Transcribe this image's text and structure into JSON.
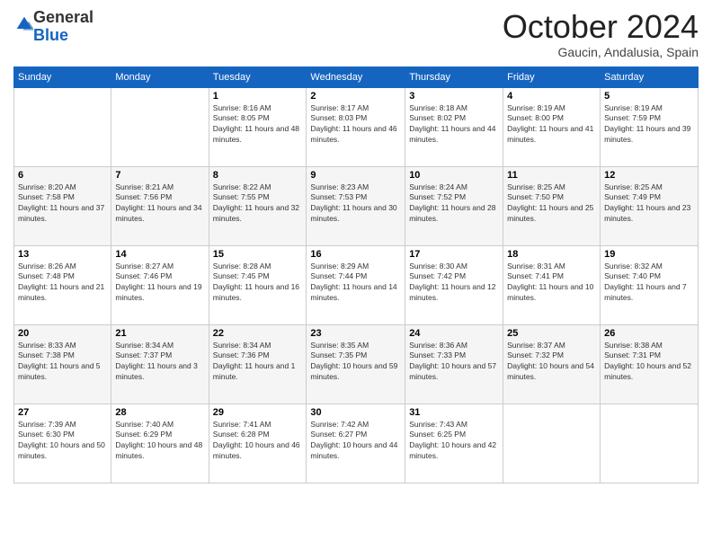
{
  "logo": {
    "general": "General",
    "blue": "Blue"
  },
  "header": {
    "month": "October 2024",
    "location": "Gaucin, Andalusia, Spain"
  },
  "weekdays": [
    "Sunday",
    "Monday",
    "Tuesday",
    "Wednesday",
    "Thursday",
    "Friday",
    "Saturday"
  ],
  "weeks": [
    [
      {
        "day": "",
        "info": ""
      },
      {
        "day": "",
        "info": ""
      },
      {
        "day": "1",
        "info": "Sunrise: 8:16 AM\nSunset: 8:05 PM\nDaylight: 11 hours and 48 minutes."
      },
      {
        "day": "2",
        "info": "Sunrise: 8:17 AM\nSunset: 8:03 PM\nDaylight: 11 hours and 46 minutes."
      },
      {
        "day": "3",
        "info": "Sunrise: 8:18 AM\nSunset: 8:02 PM\nDaylight: 11 hours and 44 minutes."
      },
      {
        "day": "4",
        "info": "Sunrise: 8:19 AM\nSunset: 8:00 PM\nDaylight: 11 hours and 41 minutes."
      },
      {
        "day": "5",
        "info": "Sunrise: 8:19 AM\nSunset: 7:59 PM\nDaylight: 11 hours and 39 minutes."
      }
    ],
    [
      {
        "day": "6",
        "info": "Sunrise: 8:20 AM\nSunset: 7:58 PM\nDaylight: 11 hours and 37 minutes."
      },
      {
        "day": "7",
        "info": "Sunrise: 8:21 AM\nSunset: 7:56 PM\nDaylight: 11 hours and 34 minutes."
      },
      {
        "day": "8",
        "info": "Sunrise: 8:22 AM\nSunset: 7:55 PM\nDaylight: 11 hours and 32 minutes."
      },
      {
        "day": "9",
        "info": "Sunrise: 8:23 AM\nSunset: 7:53 PM\nDaylight: 11 hours and 30 minutes."
      },
      {
        "day": "10",
        "info": "Sunrise: 8:24 AM\nSunset: 7:52 PM\nDaylight: 11 hours and 28 minutes."
      },
      {
        "day": "11",
        "info": "Sunrise: 8:25 AM\nSunset: 7:50 PM\nDaylight: 11 hours and 25 minutes."
      },
      {
        "day": "12",
        "info": "Sunrise: 8:25 AM\nSunset: 7:49 PM\nDaylight: 11 hours and 23 minutes."
      }
    ],
    [
      {
        "day": "13",
        "info": "Sunrise: 8:26 AM\nSunset: 7:48 PM\nDaylight: 11 hours and 21 minutes."
      },
      {
        "day": "14",
        "info": "Sunrise: 8:27 AM\nSunset: 7:46 PM\nDaylight: 11 hours and 19 minutes."
      },
      {
        "day": "15",
        "info": "Sunrise: 8:28 AM\nSunset: 7:45 PM\nDaylight: 11 hours and 16 minutes."
      },
      {
        "day": "16",
        "info": "Sunrise: 8:29 AM\nSunset: 7:44 PM\nDaylight: 11 hours and 14 minutes."
      },
      {
        "day": "17",
        "info": "Sunrise: 8:30 AM\nSunset: 7:42 PM\nDaylight: 11 hours and 12 minutes."
      },
      {
        "day": "18",
        "info": "Sunrise: 8:31 AM\nSunset: 7:41 PM\nDaylight: 11 hours and 10 minutes."
      },
      {
        "day": "19",
        "info": "Sunrise: 8:32 AM\nSunset: 7:40 PM\nDaylight: 11 hours and 7 minutes."
      }
    ],
    [
      {
        "day": "20",
        "info": "Sunrise: 8:33 AM\nSunset: 7:38 PM\nDaylight: 11 hours and 5 minutes."
      },
      {
        "day": "21",
        "info": "Sunrise: 8:34 AM\nSunset: 7:37 PM\nDaylight: 11 hours and 3 minutes."
      },
      {
        "day": "22",
        "info": "Sunrise: 8:34 AM\nSunset: 7:36 PM\nDaylight: 11 hours and 1 minute."
      },
      {
        "day": "23",
        "info": "Sunrise: 8:35 AM\nSunset: 7:35 PM\nDaylight: 10 hours and 59 minutes."
      },
      {
        "day": "24",
        "info": "Sunrise: 8:36 AM\nSunset: 7:33 PM\nDaylight: 10 hours and 57 minutes."
      },
      {
        "day": "25",
        "info": "Sunrise: 8:37 AM\nSunset: 7:32 PM\nDaylight: 10 hours and 54 minutes."
      },
      {
        "day": "26",
        "info": "Sunrise: 8:38 AM\nSunset: 7:31 PM\nDaylight: 10 hours and 52 minutes."
      }
    ],
    [
      {
        "day": "27",
        "info": "Sunrise: 7:39 AM\nSunset: 6:30 PM\nDaylight: 10 hours and 50 minutes."
      },
      {
        "day": "28",
        "info": "Sunrise: 7:40 AM\nSunset: 6:29 PM\nDaylight: 10 hours and 48 minutes."
      },
      {
        "day": "29",
        "info": "Sunrise: 7:41 AM\nSunset: 6:28 PM\nDaylight: 10 hours and 46 minutes."
      },
      {
        "day": "30",
        "info": "Sunrise: 7:42 AM\nSunset: 6:27 PM\nDaylight: 10 hours and 44 minutes."
      },
      {
        "day": "31",
        "info": "Sunrise: 7:43 AM\nSunset: 6:25 PM\nDaylight: 10 hours and 42 minutes."
      },
      {
        "day": "",
        "info": ""
      },
      {
        "day": "",
        "info": ""
      }
    ]
  ]
}
